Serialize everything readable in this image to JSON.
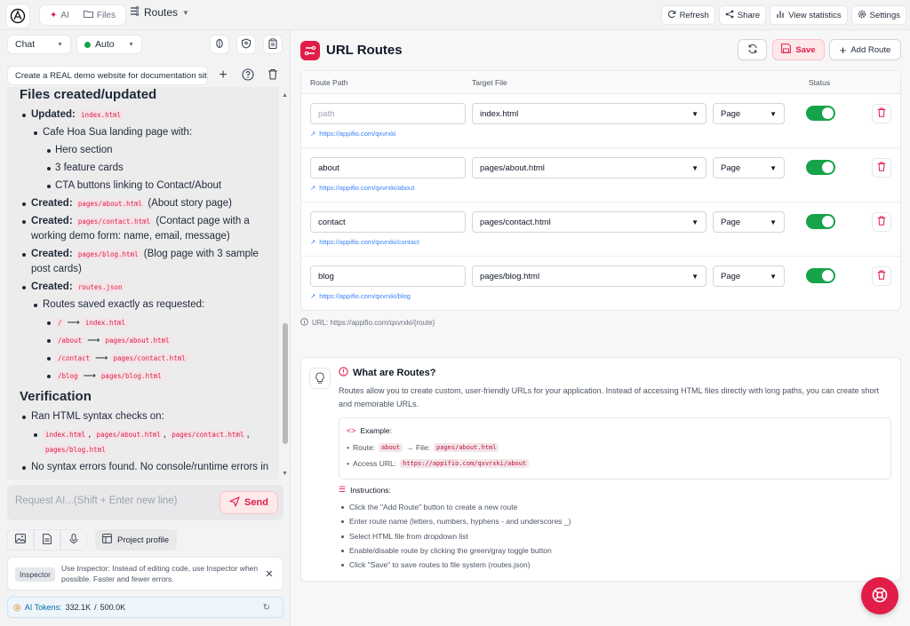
{
  "topbar": {
    "tabs": [
      {
        "label": "AI",
        "icon": "sparkle-icon"
      },
      {
        "label": "Files",
        "icon": "folder-icon"
      }
    ],
    "routes_label": "Routes",
    "actions": [
      {
        "label": "Refresh",
        "icon": "refresh-icon"
      },
      {
        "label": "Share",
        "icon": "share-icon"
      },
      {
        "label": "View statistics",
        "icon": "bar-chart-icon"
      },
      {
        "label": "Settings",
        "icon": "gear-icon"
      }
    ]
  },
  "sidebar": {
    "mode_select": "Chat",
    "model_select": "Auto",
    "prompt_text": "Create a REAL demo website for documentation site",
    "chat": {
      "h_files": "Files created/updated",
      "updated_label": "Updated:",
      "updated_file": "index.html",
      "landing": "Cafe Hoa Sua landing page with:",
      "hero": "Hero section",
      "features": "3 feature cards",
      "cta": "CTA buttons linking to Contact/About",
      "created_label": "Created:",
      "about_file": "pages/about.html",
      "about_desc": "(About story page)",
      "contact_file": "pages/contact.html",
      "contact_desc": "(Contact page with a working demo form: name, email, message)",
      "blog_file": "pages/blog.html",
      "blog_desc": "(Blog page with 3 sample post cards)",
      "routes_file": "routes.json",
      "routes_saved": "Routes saved exactly as requested:",
      "route_map": [
        {
          "from": "/",
          "to": "index.html"
        },
        {
          "from": "/about",
          "to": "pages/about.html"
        },
        {
          "from": "/contact",
          "to": "pages/contact.html"
        },
        {
          "from": "/blog",
          "to": "pages/blog.html"
        }
      ],
      "h_verification": "Verification",
      "syntax_checks": "Ran HTML syntax checks on:",
      "checked_files": [
        "index.html",
        "pages/about.html",
        "pages/contact.html",
        "pages/blog.html"
      ],
      "no_errors": "No syntax errors found. No console/runtime errors in"
    },
    "request_placeholder": "Request AI...(Shift + Enter new line)",
    "send_label": "Send",
    "project_profile": "Project profile",
    "inspector_badge": "Inspector",
    "inspector_text": "Use Inspector: Instead of editing code, use Inspector when possible. Faster and fewer errors.",
    "tokens_label": "AI Tokens:",
    "tokens_used": "332.1K",
    "tokens_sep": "/",
    "tokens_total": "500.0K"
  },
  "main": {
    "title": "URL Routes",
    "save_label": "Save",
    "add_route_label": "Add Route",
    "columns": {
      "path": "Route Path",
      "file": "Target File",
      "status": "Status"
    },
    "routes": [
      {
        "path": "",
        "placeholder": "path",
        "file": "index.html",
        "type": "Page",
        "url": "https://appifio.com/qxvrxki",
        "enabled": true
      },
      {
        "path": "about",
        "placeholder": "",
        "file": "pages/about.html",
        "type": "Page",
        "url": "https://appifio.com/qxvrxki/about",
        "enabled": true
      },
      {
        "path": "contact",
        "placeholder": "",
        "file": "pages/contact.html",
        "type": "Page",
        "url": "https://appifio.com/qxvrxki/contact",
        "enabled": true
      },
      {
        "path": "blog",
        "placeholder": "",
        "file": "pages/blog.html",
        "type": "Page",
        "url": "https://appifio.com/qxvrxki/blog",
        "enabled": true
      }
    ],
    "url_note": "URL: https://appifio.com/qxvrxki/{route}",
    "info": {
      "title": "What are Routes?",
      "desc": "Routes allow you to create custom, user-friendly URLs for your application. Instead of accessing HTML files directly with long paths, you can create short and memorable URLs.",
      "example_title": "Example:",
      "route_label": "Route:",
      "route_value": "about",
      "file_label": "→ File:",
      "file_value": "pages/about.html",
      "access_label": "Access URL:",
      "access_value": "https://appifio.com/qxvrxki/about",
      "instructions_title": "Instructions:",
      "instructions": [
        "Click the \"Add Route\" button to create a new route",
        "Enter route name (letters, numbers, hyphens - and underscores _)",
        "Select HTML file from dropdown list",
        "Enable/disable route by clicking the green/gray toggle button",
        "Click \"Save\" to save routes to file system (routes.json)"
      ]
    }
  },
  "colors": {
    "accent": "#e11d48",
    "toggle_on": "#16a34a",
    "link": "#3b82f6"
  }
}
